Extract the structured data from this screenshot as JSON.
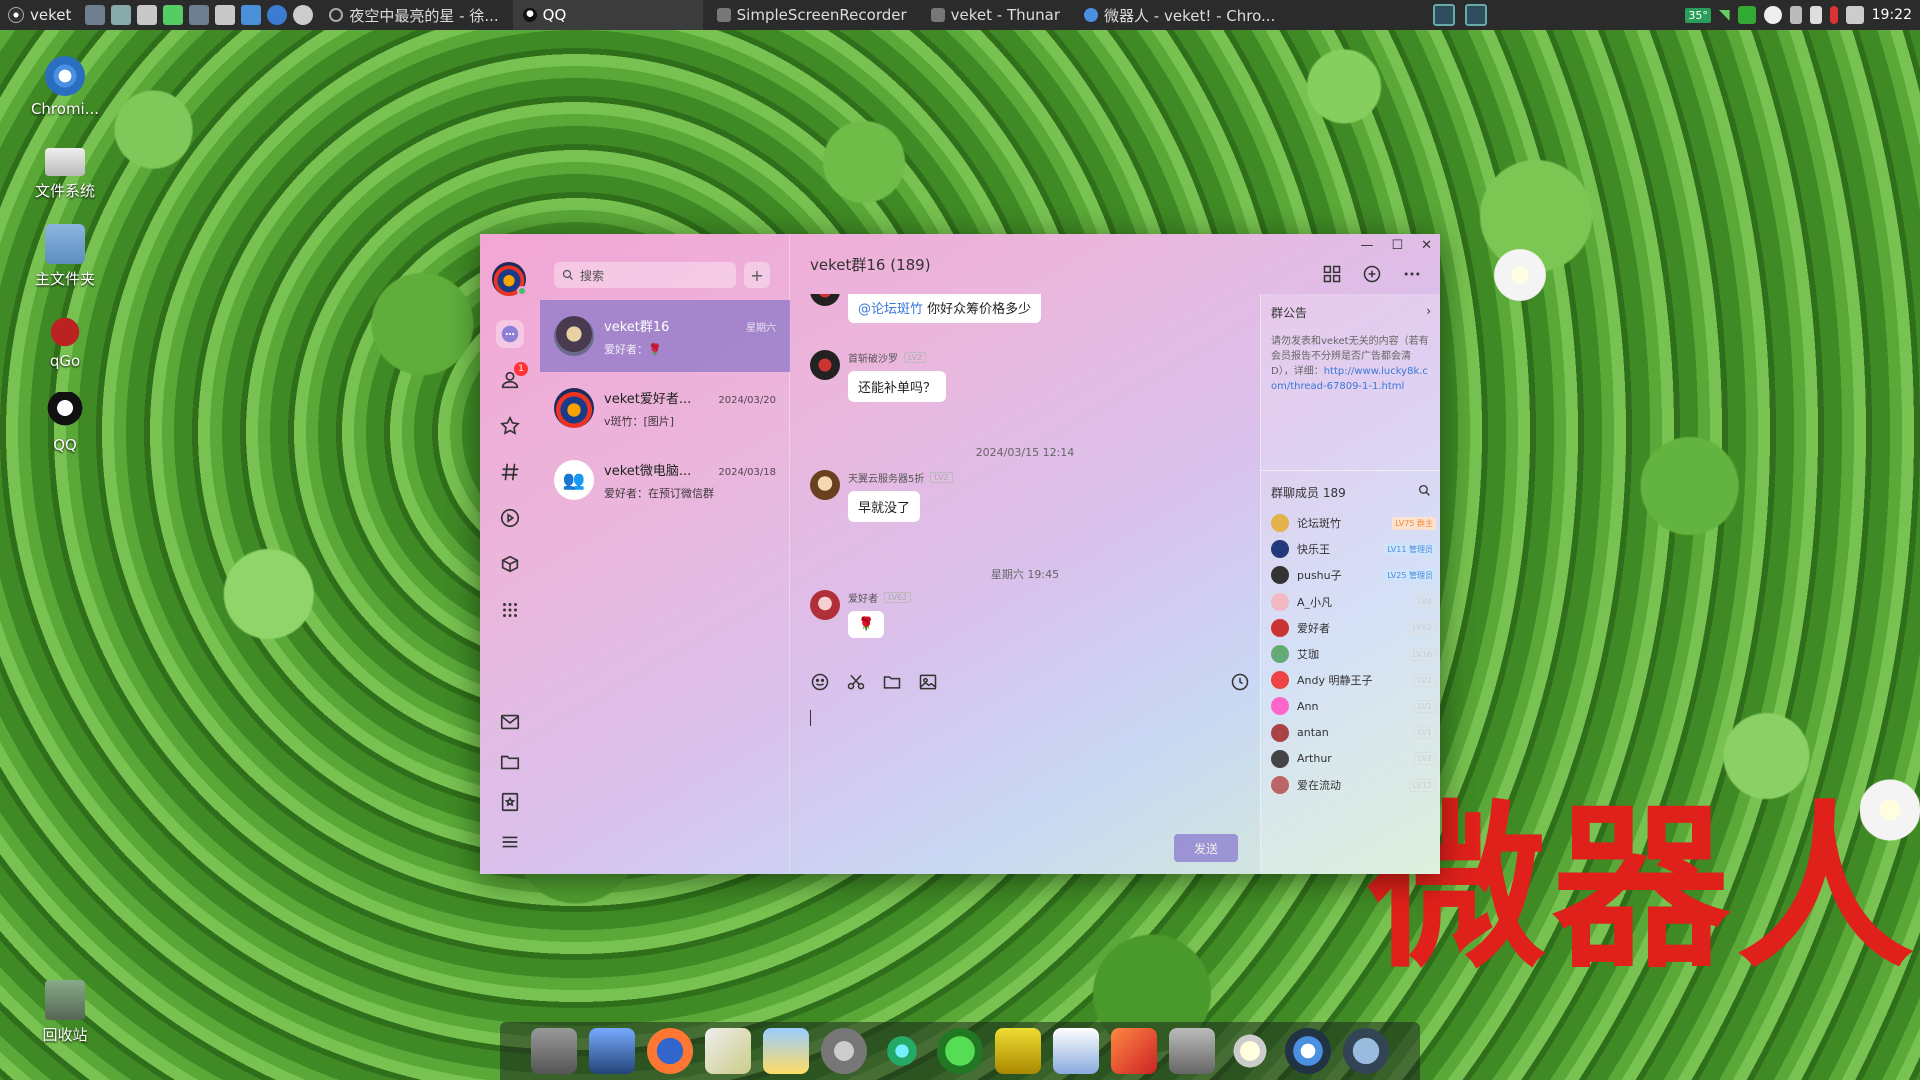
{
  "panel": {
    "menu_label": "veket",
    "tasks": [
      {
        "label": "夜空中最亮的星 - 徐...",
        "icon": "ring-icon",
        "active": false
      },
      {
        "label": "QQ",
        "icon": "qq-icon",
        "active": true
      },
      {
        "label": "SimpleScreenRecorder",
        "icon": "recorder-icon",
        "active": false
      },
      {
        "label": "veket - Thunar",
        "icon": "folder-icon",
        "active": false
      },
      {
        "label": "微器人 - veket! - Chro...",
        "icon": "chrome-icon",
        "active": false
      }
    ],
    "temperature": "35°",
    "clock": "19:22"
  },
  "desktop": {
    "icons": [
      {
        "label": "Chromi...",
        "icon": "chromium-icon"
      },
      {
        "label": "文件系统",
        "icon": "drive-icon"
      },
      {
        "label": "主文件夹",
        "icon": "home-folder-icon"
      },
      {
        "label": "qGo",
        "icon": "qgo-icon"
      },
      {
        "label": "QQ",
        "icon": "qq-penguin-icon"
      },
      {
        "label": "回收站",
        "icon": "trash-icon"
      }
    ],
    "watermark": "微器人"
  },
  "qq": {
    "rail": {
      "contacts_badge": "1"
    },
    "search_placeholder": "搜索",
    "add_label": "+",
    "conversations": [
      {
        "name": "veket群16",
        "time": "星期六",
        "preview": "爱好者：🌹"
      },
      {
        "name": "veket爱好者...",
        "time": "2024/03/20",
        "preview": "v斑竹：[图片]"
      },
      {
        "name": "veket微电脑...",
        "time": "2024/03/18",
        "preview": "爱好者：在预订微信群"
      }
    ],
    "chat": {
      "title": "veket群16 (189)",
      "messages_top": {
        "mention": "@论坛斑竹",
        "text": " 你好众筹价格多少"
      },
      "messages": [
        {
          "sender": "首斩破沙罗",
          "level": "LV2",
          "text": "还能补单吗？"
        },
        {
          "sender": "天翼云服务器5折",
          "level": "LV2",
          "text": "早就没了"
        },
        {
          "sender": "爱好者",
          "level": "LV62",
          "text": "🌹"
        }
      ],
      "separators": [
        "2024/03/15 12:14",
        "星期六 19:45"
      ],
      "send_label": "发送"
    },
    "notice": {
      "title": "群公告",
      "body": "请勿发表和veket无关的内容（若有会员报告不分辨是否广告都会清D），详细：",
      "link": "http://www.lucky8k.com/thread-67809-1-1.html"
    },
    "members": {
      "title": "群聊成员 189",
      "list": [
        {
          "name": "论坛斑竹",
          "tag": "LV75 群主",
          "tag_type": "owner"
        },
        {
          "name": "快乐王",
          "tag": "LV11 管理员",
          "tag_type": "admin"
        },
        {
          "name": "pushu子",
          "tag": "LV25 管理员",
          "tag_type": "admin"
        },
        {
          "name": "A_小凡",
          "tag": "LV4",
          "tag_type": "lv"
        },
        {
          "name": "爱好者",
          "tag": "LV62",
          "tag_type": "lv"
        },
        {
          "name": "艾珈",
          "tag": "LV16",
          "tag_type": "lv"
        },
        {
          "name": "Andy 明静王子",
          "tag": "LV2",
          "tag_type": "lv"
        },
        {
          "name": "Ann",
          "tag": "LV1",
          "tag_type": "lv"
        },
        {
          "name": "antan",
          "tag": "LV1",
          "tag_type": "lv"
        },
        {
          "name": "Arthur",
          "tag": "LV2",
          "tag_type": "lv"
        },
        {
          "name": "爱在流动",
          "tag": "LV12",
          "tag_type": "lv"
        }
      ]
    }
  }
}
